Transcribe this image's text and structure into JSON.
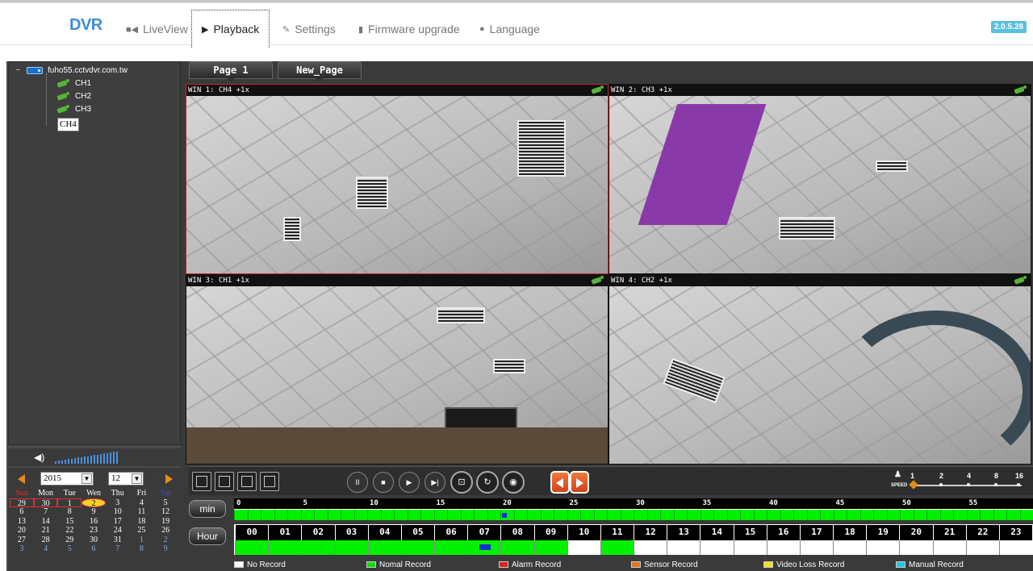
{
  "nav": {
    "brand": "DVR",
    "items": [
      {
        "label": "LiveView",
        "icon": "video-camera-icon"
      },
      {
        "label": "Playback",
        "icon": "play-icon",
        "active": true
      },
      {
        "label": "Settings",
        "icon": "wrench-icon"
      },
      {
        "label": "Firmware upgrade",
        "icon": "file-icon"
      },
      {
        "label": "Language",
        "icon": "globe-icon"
      }
    ],
    "version": "2.0.5.28"
  },
  "tree": {
    "root": "fuho55.cctvdvr.com.tw",
    "root_toggle": "−",
    "channels": [
      "CH1",
      "CH2",
      "CH3",
      "CH4"
    ],
    "selected": "CH4"
  },
  "calendar": {
    "year": "2015",
    "month": "12",
    "weekdays": [
      "Sun",
      "Mon",
      "Tue",
      "Wen",
      "Thu",
      "Fri",
      "Sat"
    ],
    "weeks": [
      [
        "29",
        "30",
        "1",
        "2",
        "3",
        "4",
        "5"
      ],
      [
        "6",
        "7",
        "8",
        "9",
        "10",
        "11",
        "12"
      ],
      [
        "13",
        "14",
        "15",
        "16",
        "17",
        "18",
        "19"
      ],
      [
        "20",
        "21",
        "22",
        "23",
        "24",
        "25",
        "26"
      ],
      [
        "27",
        "28",
        "29",
        "30",
        "31",
        "1",
        "2"
      ],
      [
        "3",
        "4",
        "5",
        "6",
        "7",
        "8",
        "9"
      ]
    ],
    "today": "2",
    "recorded_days": [
      "29",
      "30",
      "1",
      "2"
    ]
  },
  "pages": [
    "Page 1",
    "New_Page"
  ],
  "windows": [
    {
      "title": "WIN 1: CH4 +1x",
      "active": true
    },
    {
      "title": "WIN 2: CH3 +1x"
    },
    {
      "title": "WIN 3: CH1 +1x"
    },
    {
      "title": "WIN 4: CH2 +1x"
    }
  ],
  "playback": {
    "buttons": [
      "pause",
      "stop",
      "play",
      "step",
      "snapshot",
      "reload",
      "eye"
    ],
    "glyphs": {
      "pause": "II",
      "stop": "■",
      "play": "▶",
      "step": "▶|",
      "snapshot": "⊡",
      "reload": "↻",
      "eye": "◉"
    },
    "speed_label": "SPEED",
    "speeds": [
      "1",
      "2",
      "4",
      "8",
      "16"
    ],
    "speed_value": 1
  },
  "timeline": {
    "min_label": "min",
    "hour_label": "Hour",
    "minute_labels": {
      "0": "0",
      "5": "5",
      "10": "10",
      "15": "15",
      "20": "20",
      "25": "25",
      "30": "30",
      "35": "35",
      "40": "40",
      "45": "45",
      "50": "50",
      "55": "55"
    },
    "hours": [
      "00",
      "01",
      "02",
      "03",
      "04",
      "05",
      "06",
      "07",
      "08",
      "09",
      "10",
      "11",
      "12",
      "13",
      "14",
      "15",
      "16",
      "17",
      "18",
      "19",
      "20",
      "21",
      "22",
      "23"
    ],
    "hour_recorded": [
      true,
      true,
      true,
      true,
      true,
      true,
      true,
      true,
      true,
      true,
      false,
      true,
      false,
      false,
      false,
      false,
      false,
      false,
      false,
      false,
      false,
      false,
      false,
      false
    ]
  },
  "legend": [
    {
      "label": "No Record",
      "color": "#ffffff"
    },
    {
      "label": "Nomal Record",
      "color": "#00e000"
    },
    {
      "label": "Alarm Record",
      "color": "#e02020"
    },
    {
      "label": "Sensor Record",
      "color": "#e07820"
    },
    {
      "label": "Video Loss Record",
      "color": "#f0e020"
    },
    {
      "label": "Manual Record",
      "color": "#20c8d8"
    }
  ]
}
